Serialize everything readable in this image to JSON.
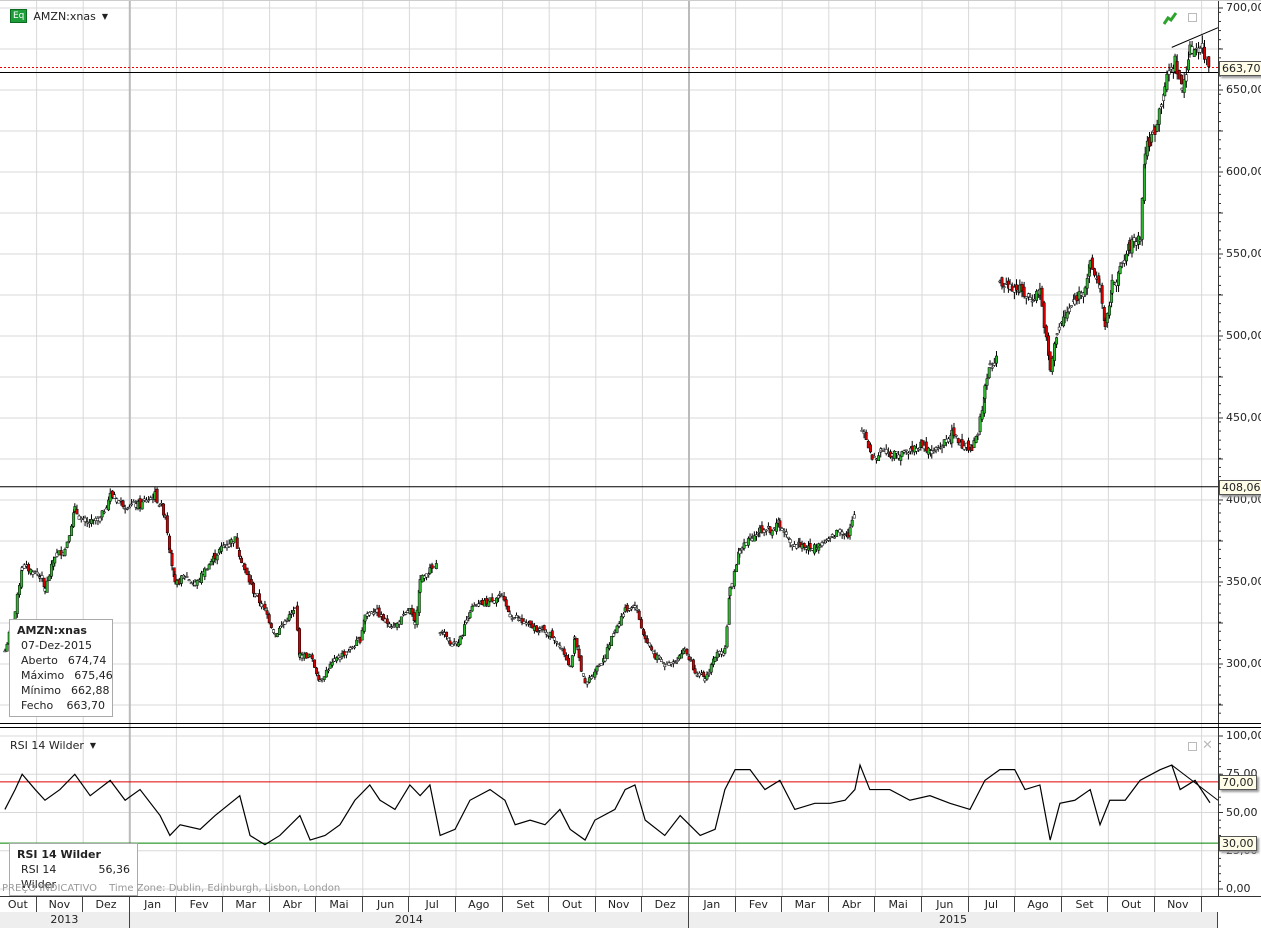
{
  "header": {
    "symbol": "AMZN:xnas",
    "badge": "Eq"
  },
  "legend": {
    "title": "AMZN:xnas",
    "date": "07-Dez-2015",
    "rows": [
      [
        "Aberto",
        "674,74"
      ],
      [
        "Máximo",
        "675,46"
      ],
      [
        "Mínimo",
        "662,88"
      ],
      [
        "Fecho",
        "663,70"
      ]
    ]
  },
  "rsi_panel": {
    "title": "RSI 14 Wilder",
    "legend_title": "RSI 14 Wilder",
    "legend_label": "RSI 14 Wilder",
    "legend_value": "56,36"
  },
  "footer": {
    "note": "PREÇO INDICATIVO",
    "timezone": "Time Zone: Dublin, Edinburgh, Lisbon, London"
  },
  "colors": {
    "up": "#2db52d",
    "down": "#d40000",
    "overbought": "#e00000",
    "oversold": "#008000"
  },
  "chart_data": [
    {
      "type": "candlestick",
      "title": "AMZN:xnas",
      "x_unit": "months since 2013-10-01",
      "ylim": [
        265,
        705
      ],
      "y_ticks": [
        "700,00",
        "650,00",
        "600,00",
        "550,00",
        "500,00",
        "450,00",
        "400,00",
        "350,00",
        "300,00"
      ],
      "y_tick_values": [
        700,
        650,
        600,
        550,
        500,
        450,
        400,
        350,
        300
      ],
      "price_flags": [
        {
          "value": 663.7,
          "label": "663,70"
        },
        {
          "value": 408.06,
          "label": "408,06"
        }
      ],
      "trendline": [
        [
          25.36,
          676
        ],
        [
          26.35,
          688
        ]
      ],
      "closes": [
        [
          0.32,
          308
        ],
        [
          0.54,
          332
        ],
        [
          0.69,
          360
        ],
        [
          1.07,
          354
        ],
        [
          1.18,
          345
        ],
        [
          1.39,
          366
        ],
        [
          1.61,
          370
        ],
        [
          1.82,
          394
        ],
        [
          2.04,
          385
        ],
        [
          2.36,
          388
        ],
        [
          2.58,
          403
        ],
        [
          2.9,
          397
        ],
        [
          3.22,
          397
        ],
        [
          3.54,
          403
        ],
        [
          3.76,
          391
        ],
        [
          3.86,
          370
        ],
        [
          3.97,
          348
        ],
        [
          4.18,
          354
        ],
        [
          4.4,
          348
        ],
        [
          4.61,
          357
        ],
        [
          4.83,
          366
        ],
        [
          5.04,
          373
        ],
        [
          5.26,
          376
        ],
        [
          5.47,
          357
        ],
        [
          5.69,
          342
        ],
        [
          5.9,
          333
        ],
        [
          6.12,
          318
        ],
        [
          6.33,
          326
        ],
        [
          6.55,
          333
        ],
        [
          6.65,
          305
        ],
        [
          6.87,
          305
        ],
        [
          7.08,
          290
        ],
        [
          7.3,
          299
        ],
        [
          7.51,
          305
        ],
        [
          7.73,
          309
        ],
        [
          7.94,
          315
        ],
        [
          8.05,
          330
        ],
        [
          8.26,
          333
        ],
        [
          8.48,
          326
        ],
        [
          8.69,
          323
        ],
        [
          9.01,
          333
        ],
        [
          9.12,
          323
        ],
        [
          9.23,
          351
        ],
        [
          9.44,
          357
        ],
        [
          9.61,
          360
        ],
        [
          9.64,
          null
        ],
        [
          9.66,
          321
        ],
        [
          9.87,
          312
        ],
        [
          10.09,
          315
        ],
        [
          10.3,
          333
        ],
        [
          10.52,
          336
        ],
        [
          10.73,
          339
        ],
        [
          10.94,
          342
        ],
        [
          11.16,
          330
        ],
        [
          11.37,
          326
        ],
        [
          11.59,
          323
        ],
        [
          11.8,
          321
        ],
        [
          12.02,
          318
        ],
        [
          12.23,
          312
        ],
        [
          12.45,
          299
        ],
        [
          12.55,
          315
        ],
        [
          12.77,
          287
        ],
        [
          12.98,
          296
        ],
        [
          13.2,
          305
        ],
        [
          13.41,
          321
        ],
        [
          13.63,
          333
        ],
        [
          13.84,
          336
        ],
        [
          14.06,
          315
        ],
        [
          14.27,
          305
        ],
        [
          14.48,
          299
        ],
        [
          14.7,
          302
        ],
        [
          14.91,
          309
        ],
        [
          15.13,
          296
        ],
        [
          15.34,
          290
        ],
        [
          15.56,
          305
        ],
        [
          15.77,
          309
        ],
        [
          15.88,
          345
        ],
        [
          16.09,
          370
        ],
        [
          16.31,
          376
        ],
        [
          16.52,
          382
        ],
        [
          16.74,
          382
        ],
        [
          16.95,
          385
        ],
        [
          17.17,
          373
        ],
        [
          17.38,
          373
        ],
        [
          17.6,
          370
        ],
        [
          17.81,
          373
        ],
        [
          18.03,
          376
        ],
        [
          18.24,
          382
        ],
        [
          18.41,
          379
        ],
        [
          18.56,
          391
        ],
        [
          18.64,
          null
        ],
        [
          18.71,
          443
        ],
        [
          18.93,
          425
        ],
        [
          19.14,
          431
        ],
        [
          19.36,
          428
        ],
        [
          19.57,
          428
        ],
        [
          19.79,
          431
        ],
        [
          20.0,
          434
        ],
        [
          20.21,
          428
        ],
        [
          20.43,
          434
        ],
        [
          20.64,
          440
        ],
        [
          20.86,
          434
        ],
        [
          21.07,
          431
        ],
        [
          21.2,
          440
        ],
        [
          21.35,
          467
        ],
        [
          21.46,
          482
        ],
        [
          21.61,
          488
        ],
        [
          21.64,
          null
        ],
        [
          21.67,
          531
        ],
        [
          21.89,
          531
        ],
        [
          22.1,
          528
        ],
        [
          22.32,
          522
        ],
        [
          22.53,
          528
        ],
        [
          22.75,
          479
        ],
        [
          22.9,
          503
        ],
        [
          23.07,
          512
        ],
        [
          23.28,
          522
        ],
        [
          23.5,
          531
        ],
        [
          23.61,
          543
        ],
        [
          23.82,
          531
        ],
        [
          23.93,
          503
        ],
        [
          24.08,
          531
        ],
        [
          24.25,
          540
        ],
        [
          24.46,
          555
        ],
        [
          24.68,
          561
        ],
        [
          24.79,
          613
        ],
        [
          25.0,
          626
        ],
        [
          25.21,
          653
        ],
        [
          25.43,
          668
        ],
        [
          25.58,
          650
        ],
        [
          25.75,
          674
        ],
        [
          25.97,
          677
        ],
        [
          26.18,
          663.7
        ]
      ]
    },
    {
      "type": "line",
      "title": "RSI 14 Wilder",
      "ylim": [
        0,
        100
      ],
      "y_ticks": [
        "100,00",
        "75,00",
        "50,00",
        "25,00",
        "0,00"
      ],
      "y_tick_values": [
        100,
        75,
        50,
        25,
        0
      ],
      "levels": [
        {
          "value": 70,
          "label": "70,00"
        },
        {
          "value": 30,
          "label": "30,00"
        }
      ],
      "trendline": [
        [
          25.36,
          81
        ],
        [
          26.35,
          58
        ]
      ],
      "values": [
        [
          0.32,
          52
        ],
        [
          0.54,
          65
        ],
        [
          0.69,
          75
        ],
        [
          0.97,
          65
        ],
        [
          1.18,
          58
        ],
        [
          1.5,
          65
        ],
        [
          1.82,
          75
        ],
        [
          2.15,
          61
        ],
        [
          2.58,
          71
        ],
        [
          2.9,
          58
        ],
        [
          3.22,
          65
        ],
        [
          3.65,
          48
        ],
        [
          3.86,
          35
        ],
        [
          4.08,
          42
        ],
        [
          4.51,
          39
        ],
        [
          4.83,
          48
        ],
        [
          5.36,
          61
        ],
        [
          5.58,
          35
        ],
        [
          5.9,
          29
        ],
        [
          6.22,
          35
        ],
        [
          6.65,
          48
        ],
        [
          6.87,
          32
        ],
        [
          7.19,
          35
        ],
        [
          7.51,
          42
        ],
        [
          7.83,
          58
        ],
        [
          8.15,
          68
        ],
        [
          8.37,
          58
        ],
        [
          8.69,
          52
        ],
        [
          9.01,
          68
        ],
        [
          9.23,
          61
        ],
        [
          9.44,
          68
        ],
        [
          9.66,
          35
        ],
        [
          9.98,
          39
        ],
        [
          10.3,
          58
        ],
        [
          10.73,
          65
        ],
        [
          11.05,
          58
        ],
        [
          11.27,
          42
        ],
        [
          11.59,
          45
        ],
        [
          11.91,
          42
        ],
        [
          12.23,
          52
        ],
        [
          12.45,
          39
        ],
        [
          12.77,
          32
        ],
        [
          12.98,
          45
        ],
        [
          13.41,
          52
        ],
        [
          13.63,
          65
        ],
        [
          13.84,
          68
        ],
        [
          14.06,
          45
        ],
        [
          14.48,
          35
        ],
        [
          14.81,
          48
        ],
        [
          15.24,
          35
        ],
        [
          15.56,
          39
        ],
        [
          15.77,
          65
        ],
        [
          15.99,
          78
        ],
        [
          16.31,
          78
        ],
        [
          16.63,
          65
        ],
        [
          16.95,
          71
        ],
        [
          17.27,
          52
        ],
        [
          17.7,
          56
        ],
        [
          18.03,
          56
        ],
        [
          18.35,
          58
        ],
        [
          18.56,
          65
        ],
        [
          18.67,
          81
        ],
        [
          18.88,
          65
        ],
        [
          19.31,
          65
        ],
        [
          19.74,
          58
        ],
        [
          20.17,
          61
        ],
        [
          20.6,
          56
        ],
        [
          21.03,
          52
        ],
        [
          21.35,
          71
        ],
        [
          21.67,
          78
        ],
        [
          21.99,
          78
        ],
        [
          22.21,
          65
        ],
        [
          22.53,
          68
        ],
        [
          22.75,
          32
        ],
        [
          22.96,
          56
        ],
        [
          23.28,
          58
        ],
        [
          23.61,
          65
        ],
        [
          23.82,
          42
        ],
        [
          24.03,
          58
        ],
        [
          24.36,
          58
        ],
        [
          24.68,
          71
        ],
        [
          25.11,
          78
        ],
        [
          25.36,
          81
        ],
        [
          25.54,
          65
        ],
        [
          25.86,
          71
        ],
        [
          26.18,
          56.36
        ]
      ]
    }
  ],
  "x_axis": {
    "months": [
      "Out",
      "Nov",
      "Dez",
      "Jan",
      "Fev",
      "Mar",
      "Abr",
      "Mai",
      "Jun",
      "Jul",
      "Ago",
      "Set",
      "Out",
      "Nov",
      "Dez",
      "Jan",
      "Fev",
      "Mar",
      "Abr",
      "Mai",
      "Jun",
      "Jul",
      "Ago",
      "Set",
      "Out",
      "Nov"
    ],
    "years": [
      "2013",
      "2014",
      "2015"
    ]
  }
}
